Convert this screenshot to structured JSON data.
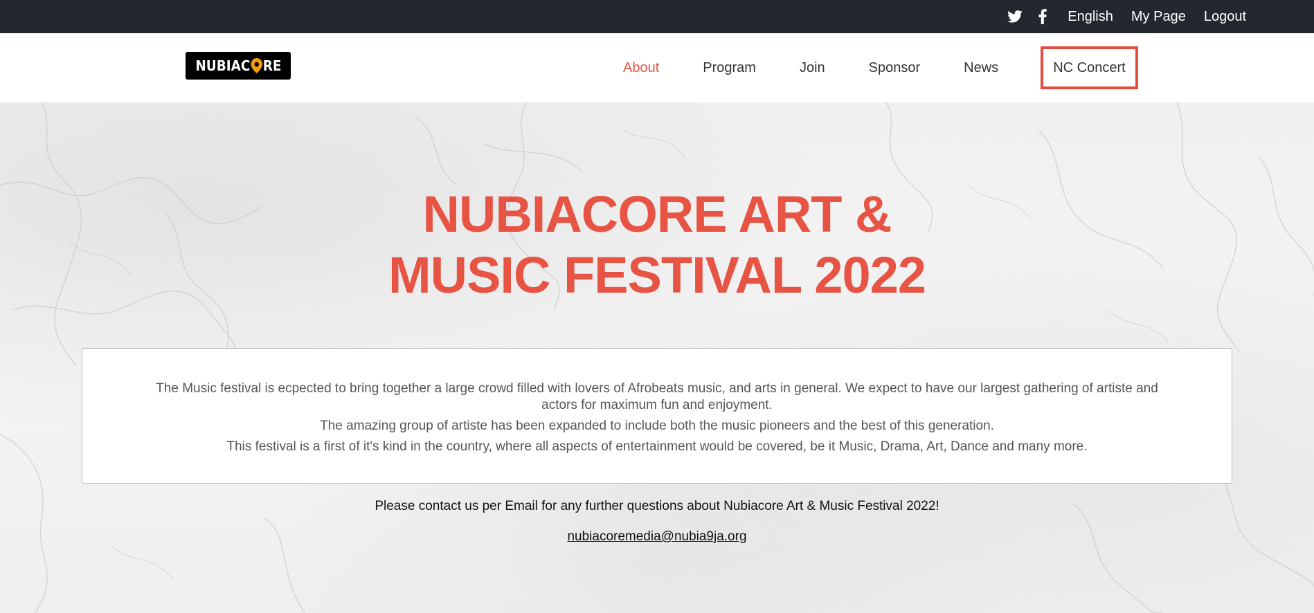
{
  "topbar": {
    "twitter_icon": "twitter-icon",
    "facebook_icon": "facebook-icon",
    "language": "English",
    "my_page": "My Page",
    "logout": "Logout"
  },
  "header": {
    "logo_text_left": "NUBIAC",
    "logo_text_right": "RE",
    "nav": [
      {
        "label": "About",
        "active": true
      },
      {
        "label": "Program"
      },
      {
        "label": "Join"
      },
      {
        "label": "Sponsor"
      },
      {
        "label": "News"
      },
      {
        "label": "NC Concert",
        "highlighted": true
      }
    ]
  },
  "hero": {
    "title_line1": "NUBIACORE ART &",
    "title_line2": "MUSIC FESTIVAL 2022",
    "paragraph1": "The Music festival is ecpected to bring together a large crowd filled with lovers of Afrobeats music, and arts in general. We expect to have our largest gathering of artiste and actors for maximum fun and enjoyment.",
    "paragraph2": "The amazing group of artiste has been expanded to include both the music pioneers and the best of this generation.",
    "paragraph3": "This festival is a first of it's kind in the country, where all aspects of entertainment would be covered, be it Music, Drama, Art, Dance and many more.",
    "contact_text": "Please contact us per Email for any further questions about Nubiacore Art & Music Festival 2022!",
    "email": "nubiacoremedia@nubia9ja.org"
  },
  "colors": {
    "accent": "#e85444",
    "topbar_bg": "#23272e",
    "nav_box_border": "#e74c3c"
  }
}
